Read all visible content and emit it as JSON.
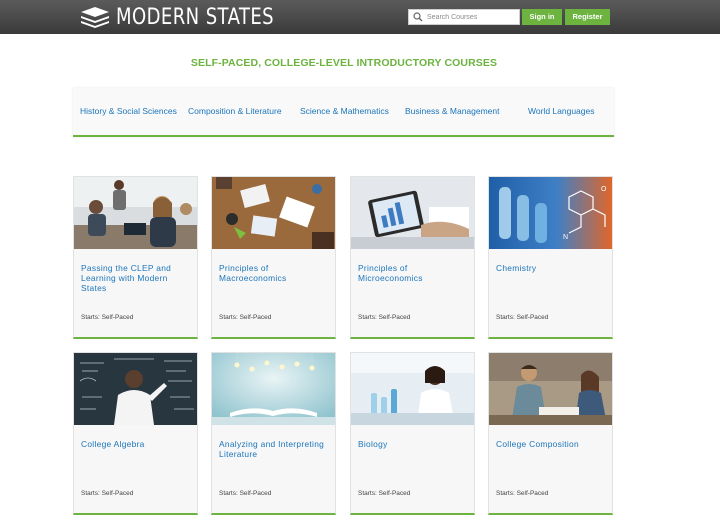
{
  "header": {
    "brand": "MODERN STATES",
    "search_placeholder": "Search Courses",
    "signin_label": "Sign in",
    "register_label": "Register"
  },
  "page_title": "SELF-PACED, COLLEGE-LEVEL INTRODUCTORY COURSES",
  "categories": [
    {
      "label": "History & Social Sciences"
    },
    {
      "label": "Composition & Literature"
    },
    {
      "label": "Science & Mathematics"
    },
    {
      "label": "Business & Management"
    },
    {
      "label": "World Languages"
    }
  ],
  "courses": [
    {
      "title": "Passing the CLEP and Learning with Modern States",
      "starts": "Starts: Self-Paced",
      "image": "classroom-students-photo"
    },
    {
      "title": "Principles of Macroeconomics",
      "starts": "Starts: Self-Paced",
      "image": "meeting-table-photo"
    },
    {
      "title": "Principles of Microeconomics",
      "starts": "Starts: Self-Paced",
      "image": "tablet-chart-photo"
    },
    {
      "title": "Chemistry",
      "starts": "Starts: Self-Paced",
      "image": "lab-glassware-photo"
    },
    {
      "title": "College Algebra",
      "starts": "Starts: Self-Paced",
      "image": "chalkboard-equations-photo"
    },
    {
      "title": "Analyzing and Interpreting Literature",
      "starts": "Starts: Self-Paced",
      "image": "open-book-lights-photo"
    },
    {
      "title": "Biology",
      "starts": "Starts: Self-Paced",
      "image": "lab-scientist-photo"
    },
    {
      "title": "College Composition",
      "starts": "Starts: Self-Paced",
      "image": "students-studying-photo"
    }
  ],
  "colors": {
    "accent_green": "#6cb33f",
    "link_blue": "#1b75bb",
    "header_dark": "#3a3a3a"
  }
}
